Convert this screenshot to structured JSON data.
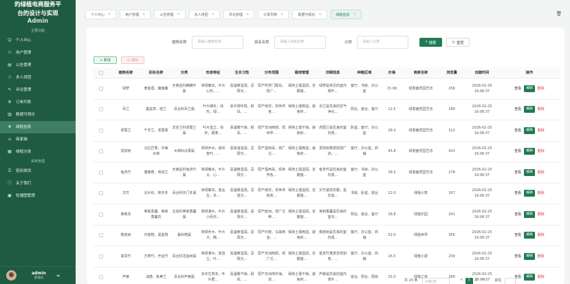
{
  "sidebar": {
    "title_line1": "的绿植电商服务平",
    "title_line2": "台的设计与实现",
    "title_sub": "Admin",
    "group_main": "主要功能",
    "items": [
      {
        "label": "个人中心",
        "icon": "user-icon"
      },
      {
        "label": "用户管理",
        "icon": "users-icon"
      },
      {
        "label": "公告管理",
        "icon": "notice-icon"
      },
      {
        "label": "多人拼团",
        "icon": "group-icon"
      },
      {
        "label": "评论管理",
        "icon": "comment-icon"
      },
      {
        "label": "订单列表",
        "icon": "order-icon"
      },
      {
        "label": "数据可视化",
        "icon": "chart-icon"
      },
      {
        "label": "绿植信息",
        "icon": "plant-icon",
        "active": true
      },
      {
        "label": "商家端",
        "icon": "shop-icon"
      },
      {
        "label": "绿植分类",
        "icon": "category-icon"
      }
    ],
    "group_system": "系统管理",
    "system_items": [
      {
        "label": "密码修改",
        "icon": "lock-icon"
      },
      {
        "label": "关于我们",
        "icon": "info-icon"
      },
      {
        "label": "轮播图管理",
        "icon": "image-icon"
      }
    ],
    "user_name": "admin",
    "user_role": "管理员"
  },
  "tabs": [
    "个人中心",
    "用户管理",
    "公告管理",
    "多人拼团",
    "评论管理",
    "订单列表",
    "数据可视化",
    "绿植信息"
  ],
  "active_tab": "绿植信息",
  "search": {
    "field1_label": "植物名称",
    "field1_placeholder": "请输入植物名称",
    "field2_label": "别名名称",
    "field2_placeholder": "请输入别名名称",
    "field3_label": "分类",
    "field3_placeholder": "请输入分类",
    "search_btn": "搜索",
    "reset_btn": "重置"
  },
  "toolbar": {
    "add_label": "+ 新增",
    "delete_label": "删除"
  },
  "table": {
    "headers": [
      "植物名称",
      "别名名称",
      "分类",
      "形态特征",
      "生长习性",
      "分布范围",
      "栽培管理",
      "详细信息",
      "种植区域",
      "价格",
      "商家名称",
      "浏览量",
      "创建时间",
      "操作"
    ],
    "rows": [
      [
        "绿萝",
        "黄金葛、魔鬼藤",
        "天南星科麒麟叶属",
        "常绿藤本，叶片心形，…",
        "喜温暖湿润，忌阳光…",
        "原产所罗门群岛，现广…",
        "保持土壤湿润，定期施…",
        "绿萝是常见的室内观叶…",
        "客厅、书房、办公室",
        "15.99",
        "绿意盎然园艺坊",
        "256",
        "2026-02-25 16:06:37"
      ],
      [
        "吊兰",
        "垂盆草、桂兰",
        "百合科吊兰属",
        "叶片细长，线形，绿…",
        "喜半阴环境，耐旱，…",
        "原产南非，现世界各…",
        "保持土壤微湿，避免积…",
        "吊兰是优良的空气净化…",
        "阳台、窗台、客厅",
        "12.5",
        "绿意盎然园艺坊",
        "189",
        "2026-02-25 16:06:37"
      ],
      [
        "虎尾兰",
        "千岁兰、虎尾掌",
        "龙舌兰科虎尾兰属",
        "叶片直立，剑形，硬革…",
        "喜温暖干燥，耐旱，…",
        "原产非洲西部，现世界…",
        "保持土壤干燥，避免积…",
        "虎尾兰是优良的室内观…",
        "卧室、客厅、办公室",
        "28.0",
        "绿意盎然园艺坊",
        "312",
        "2026-02-25 16:06:37"
      ],
      [
        "发财树",
        "马拉巴栗、中美木棉",
        "木棉科瓜栗属",
        "常绿乔木，掌状复叶，…",
        "喜高温湿润，忌阳光…",
        "原产墨西哥，现广泛…",
        "保持土壤微湿，避免积…",
        "发财树寓意财源广进，…",
        "客厅、办公室、商铺",
        "45.8",
        "绿意盎然园艺坊",
        "423",
        "2026-02-25 16:06:37"
      ],
      [
        "龟背竹",
        "蓬莱蕉、电线兰",
        "天南星科龟背竹属",
        "常绿藤本，叶片大、心…",
        "喜温暖湿润，忌阳光…",
        "原产墨西哥，现世界各…",
        "保持土壤湿润，定期施…",
        "龟背竹是优良的室内观…",
        "客厅、书房、办公室",
        "38.5",
        "绿意盎然园艺坊",
        "278",
        "2026-02-25 16:06:37"
      ],
      [
        "文竹",
        "云片松、刺天冬",
        "百合科天门冬属",
        "常绿藤本，茎丛生，多…",
        "喜温暖湿润，忌强光…",
        "原产南非，现世界各地…",
        "保持土壤湿润，定期施…",
        "文竹姿态优雅，是优良…",
        "书房、卧室、窗台",
        "22.0",
        "绿植小筑",
        "167",
        "2026-02-25 16:06:37"
      ],
      [
        "茉莉花",
        "茉莉素馨、茉莉香馨花",
        "五加科茉莉香馨属",
        "常绿灌木，叶片小而光…",
        "喜温暖湿润，喜阳光…",
        "原产欧洲，现广泛种…",
        "保持土壤湿润，定期施…",
        "茉莉香馨是优良的室内…",
        "阳台、窗台、客厅",
        "18.8",
        "绿植乐园",
        "201",
        "2026-02-25 16:06:37"
      ],
      [
        "橡皮树",
        "印度榕、黑金刚",
        "桑科榕属",
        "常绿乔木，叶片大、椭…",
        "喜温暖湿润，喜阳光…",
        "原产印度、马来西亚，…",
        "保持土壤微湿，避免积…",
        "橡皮树是优良的室内观…",
        "客厅、办公室、商铺",
        "52.0",
        "绿植世界",
        "356",
        "2026-02-25 16:06:37"
      ],
      [
        "富贵竹",
        "万寿竹、开运竹",
        "百合科龙血树属",
        "常绿灌木，茎直立，叶…",
        "喜温暖湿润，忌阳光…",
        "原产非洲西部，现广泛…",
        "保持土壤湿润，定期施…",
        "富贵竹寓意吉祥如意，…",
        "客厅、办公室、商铺",
        "16.5",
        "绿植小屋",
        "234",
        "2026-02-25 16:06:37"
      ],
      [
        "芦荟",
        "油葱、象鼻兰",
        "百合科芦荟属",
        "多年生草本，叶片肥…",
        "喜温暖干燥，耐旱，…",
        "原产非洲地中海，现…",
        "保持土壤干燥，避免积…",
        "芦荟是优良的室内观叶…",
        "窗台、阳台、厨房",
        "25.0",
        "绿植之家",
        "289",
        "2026-02-25 16:06:37"
      ]
    ],
    "op_view": "查看",
    "op_edit": "编辑",
    "op_delete": "删除"
  },
  "pager": {
    "total": "共 20 条",
    "page_size": "10条/页",
    "prev": "<",
    "pages": [
      "1",
      "2"
    ],
    "next": ">",
    "goto": "前往"
  }
}
